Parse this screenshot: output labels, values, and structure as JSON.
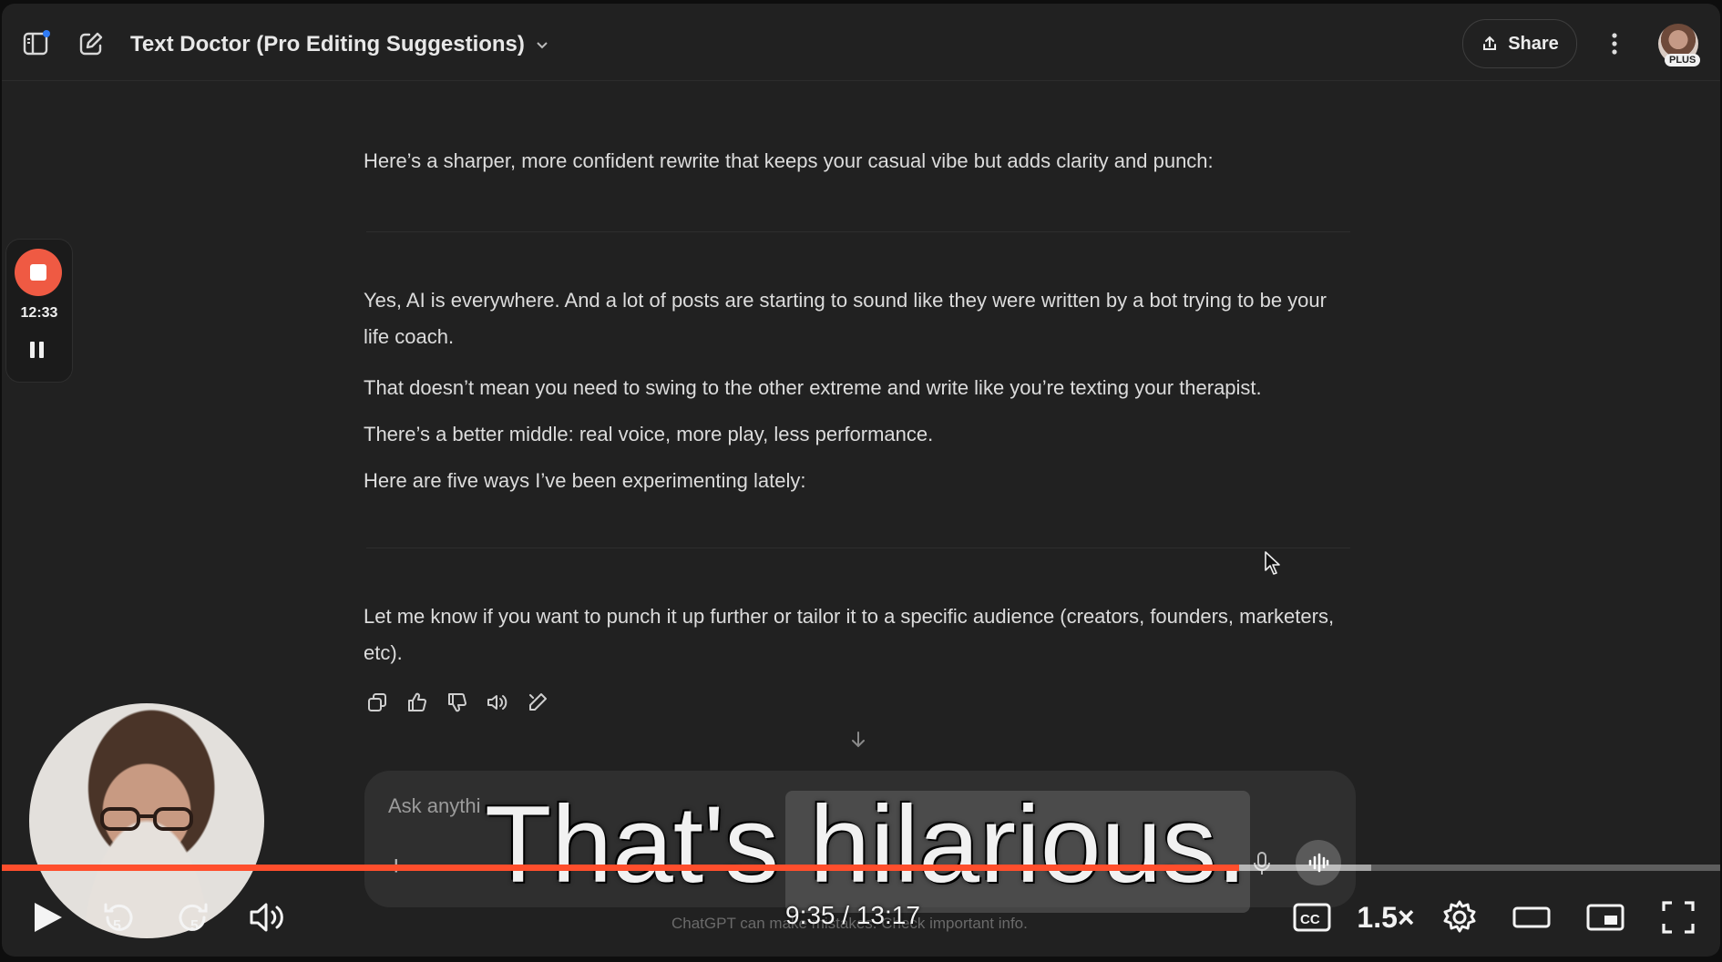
{
  "app": {
    "title": "Text Doctor (Pro Editing Suggestions)",
    "share_label": "Share",
    "plan_badge": "PLUS"
  },
  "messages": {
    "intro": "Here’s a sharper, more confident rewrite that keeps your casual vibe but adds clarity and punch:",
    "rewrite": [
      "Yes, AI is everywhere. And a lot of posts are starting to sound like they were written by a bot trying to be your life coach.",
      "That doesn’t mean you need to swing to the other extreme and write like you’re texting your therapist.",
      "There’s a better middle: real voice, more play, less performance.",
      "Here are five ways I’ve been experimenting lately:"
    ],
    "outro": "Let me know if you want to punch it up further or tailor it to a specific audience (creators, founders, marketers, etc)."
  },
  "message_actions": [
    "copy-icon",
    "thumbs-up-icon",
    "thumbs-down-icon",
    "read-aloud-icon",
    "edit-icon"
  ],
  "composer": {
    "placeholder": "Ask anythi",
    "disclaimer": "ChatGPT can make mistakes. Check important info."
  },
  "recorder": {
    "elapsed": "12:33",
    "record_color": "#ef5a43"
  },
  "video": {
    "caption": "That's hilarious.",
    "current_time": "9:35 / 13:17",
    "speed": "1.5×",
    "progress_played": 0.72,
    "progress_buffered": 0.797,
    "accent_color": "#ff4e2c"
  }
}
